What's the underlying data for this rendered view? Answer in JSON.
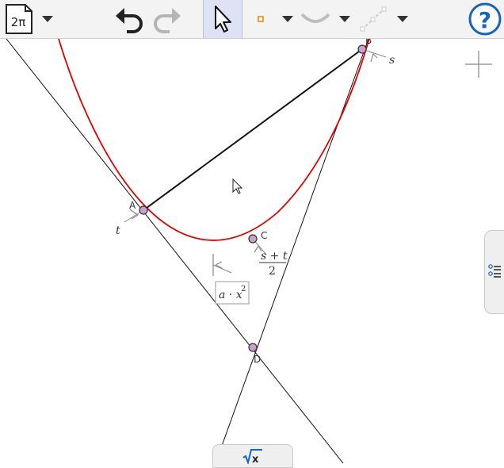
{
  "toolbar": {
    "file_menu_label": "2π",
    "tools": [
      {
        "name": "undo-icon"
      },
      {
        "name": "redo-icon"
      },
      {
        "name": "move-pointer-icon",
        "selected": true
      },
      {
        "name": "point-tool-icon"
      },
      {
        "name": "curve-tool-icon"
      },
      {
        "name": "line-tool-icon"
      },
      {
        "name": "help-icon"
      }
    ]
  },
  "colors": {
    "accent": "#1565c0",
    "curve": "#e00000",
    "point_fill": "#c8a2c8",
    "selected_bg": "#dde3f4"
  },
  "graph": {
    "points": {
      "a": "A",
      "b": "B",
      "c": "C",
      "d": "D"
    },
    "param_t": "t",
    "param_s": "s",
    "param_c_num": "s + t",
    "param_c_den": "2",
    "formula_base": "a · x",
    "formula_exp": "2"
  },
  "bottom_panel": {
    "label": "x"
  }
}
